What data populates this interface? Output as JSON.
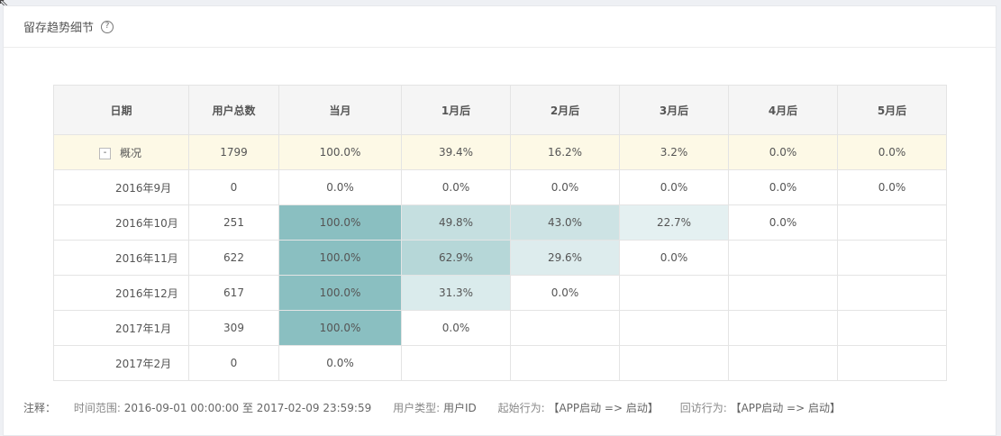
{
  "panel": {
    "title": "留存趋势细节",
    "help_symbol": "?"
  },
  "table": {
    "columns": [
      "日期",
      "用户总数",
      "当月",
      "1月后",
      "2月后",
      "3月后",
      "4月后",
      "5月后"
    ],
    "overview": {
      "toggle": "-",
      "label": "概况",
      "total": "1799",
      "values": [
        "100.0%",
        "39.4%",
        "16.2%",
        "3.2%",
        "0.0%",
        "0.0%"
      ]
    },
    "rows": [
      {
        "date": "2016年9月",
        "total": "0",
        "values": [
          "0.0%",
          "0.0%",
          "0.0%",
          "0.0%",
          "0.0%",
          "0.0%"
        ]
      },
      {
        "date": "2016年10月",
        "total": "251",
        "values": [
          "100.0%",
          "49.8%",
          "43.0%",
          "22.7%",
          "0.0%",
          ""
        ]
      },
      {
        "date": "2016年11月",
        "total": "622",
        "values": [
          "100.0%",
          "62.9%",
          "29.6%",
          "0.0%",
          "",
          ""
        ]
      },
      {
        "date": "2016年12月",
        "total": "617",
        "values": [
          "100.0%",
          "31.3%",
          "0.0%",
          "",
          "",
          ""
        ]
      },
      {
        "date": "2017年1月",
        "total": "309",
        "values": [
          "100.0%",
          "0.0%",
          "",
          "",
          "",
          ""
        ]
      },
      {
        "date": "2017年2月",
        "total": "0",
        "values": [
          "0.0%",
          "",
          "",
          "",
          "",
          ""
        ]
      }
    ],
    "heat_color_rgb": [
      138,
      191,
      193
    ]
  },
  "notes": {
    "label": "注释：",
    "time_range_label": "时间范围:",
    "time_range_value": "2016-09-01 00:00:00 至 2017-02-09 23:59:59",
    "user_type_label": "用户类型:",
    "user_type_value": "用户ID",
    "start_action_label": "起始行为:",
    "start_action_value": "【APP启动 => 启动】",
    "return_action_label": "回访行为:",
    "return_action_value": "【APP启动 => 启动】"
  }
}
